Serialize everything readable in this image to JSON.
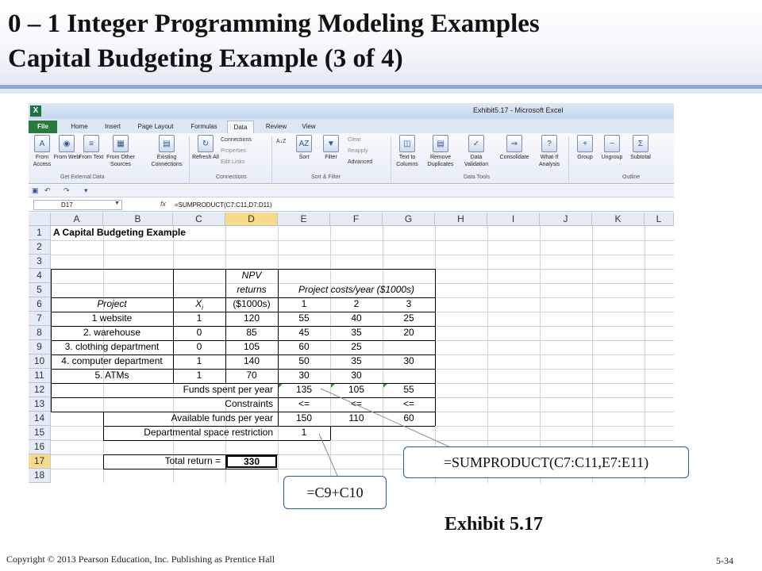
{
  "slide": {
    "title_line1": "0 – 1 Integer Programming Modeling Examples",
    "title_line2": "Capital Budgeting Example (3 of  4)",
    "exhibit_label": "Exhibit 5.17",
    "copyright": "Copyright © 2013 Pearson Education, Inc. Publishing as Prentice Hall",
    "slide_number": "5-34",
    "accent_color": "#8ea9cf"
  },
  "excel": {
    "window_title": "Exhibit5.17 - Microsoft Excel",
    "app_icon": "X",
    "tabs": [
      "File",
      "Home",
      "Insert",
      "Page Layout",
      "Formulas",
      "Data",
      "Review",
      "View"
    ],
    "active_tab": "Data",
    "ribbon": {
      "get_external_data": {
        "label": "Get External Data",
        "buttons": [
          "From Access",
          "From Web",
          "From Text",
          "From Other Sources"
        ]
      },
      "existing_connections": "Existing Connections",
      "connections": {
        "label": "Connections",
        "refresh": "Refresh All",
        "items": [
          "Connections",
          "Properties",
          "Edit Links"
        ]
      },
      "sort_filter": {
        "label": "Sort & Filter",
        "sort": "Sort",
        "filter": "Filter",
        "items": [
          "Clear",
          "Reapply",
          "Advanced"
        ]
      },
      "data_tools": {
        "label": "Data Tools",
        "buttons": [
          "Text to Columns",
          "Remove Duplicates",
          "Data Validation",
          "Consolidate",
          "What-If Analysis"
        ]
      },
      "outline": {
        "label": "Outline",
        "buttons": [
          "Group",
          "Ungroup",
          "Subtotal"
        ]
      }
    },
    "name_box": "D17",
    "fx_label": "fx",
    "formula": "=SUMPRODUCT(C7:C11,D7:D11)",
    "columns": [
      "A",
      "B",
      "C",
      "D",
      "E",
      "F",
      "G",
      "H",
      "I",
      "J",
      "K",
      "L"
    ],
    "rows": [
      "1",
      "2",
      "3",
      "4",
      "5",
      "6",
      "7",
      "8",
      "9",
      "10",
      "11",
      "12",
      "13",
      "14",
      "15",
      "16",
      "17",
      "18"
    ],
    "selected_cell": {
      "column": "D",
      "row": "17"
    },
    "sheet": {
      "title": "A Capital Budgeting Example",
      "npv_header_1": "NPV",
      "npv_header_2": "returns",
      "npv_header_3": "($1000s)",
      "costs_header": "Project costs/year ($1000s)",
      "project_header": "Project",
      "xi_header": "X",
      "xi_subscript": "i",
      "year_headers": [
        "1",
        "2",
        "3"
      ],
      "projects": [
        {
          "name": "1 website",
          "x": "1",
          "npv": "120",
          "y1": "55",
          "y2": "40",
          "y3": "25"
        },
        {
          "name": "2. warehouse",
          "x": "0",
          "npv": "85",
          "y1": "45",
          "y2": "35",
          "y3": "20"
        },
        {
          "name": "3. clothing department",
          "x": "0",
          "npv": "105",
          "y1": "60",
          "y2": "25",
          "y3": ""
        },
        {
          "name": "4. computer department",
          "x": "1",
          "npv": "140",
          "y1": "50",
          "y2": "35",
          "y3": "30"
        },
        {
          "name": "5. ATMs",
          "x": "1",
          "npv": "70",
          "y1": "30",
          "y2": "30",
          "y3": ""
        }
      ],
      "funds_spent_label": "Funds spent per year",
      "funds_spent": [
        "135",
        "105",
        "55"
      ],
      "constraints_label": "Constraints",
      "constraints": [
        "<=",
        "<=",
        "<="
      ],
      "available_funds_label": "Available funds per year",
      "available_funds": [
        "150",
        "110",
        "60"
      ],
      "dept_space_label": "Departmental space restriction",
      "dept_space_value": "1",
      "total_return_label": "Total return =",
      "total_return_value": "330"
    }
  },
  "callouts": {
    "sumproduct": "=SUMPRODUCT(C7:C11,E7:E11)",
    "c9c10": "=C9+C10"
  }
}
